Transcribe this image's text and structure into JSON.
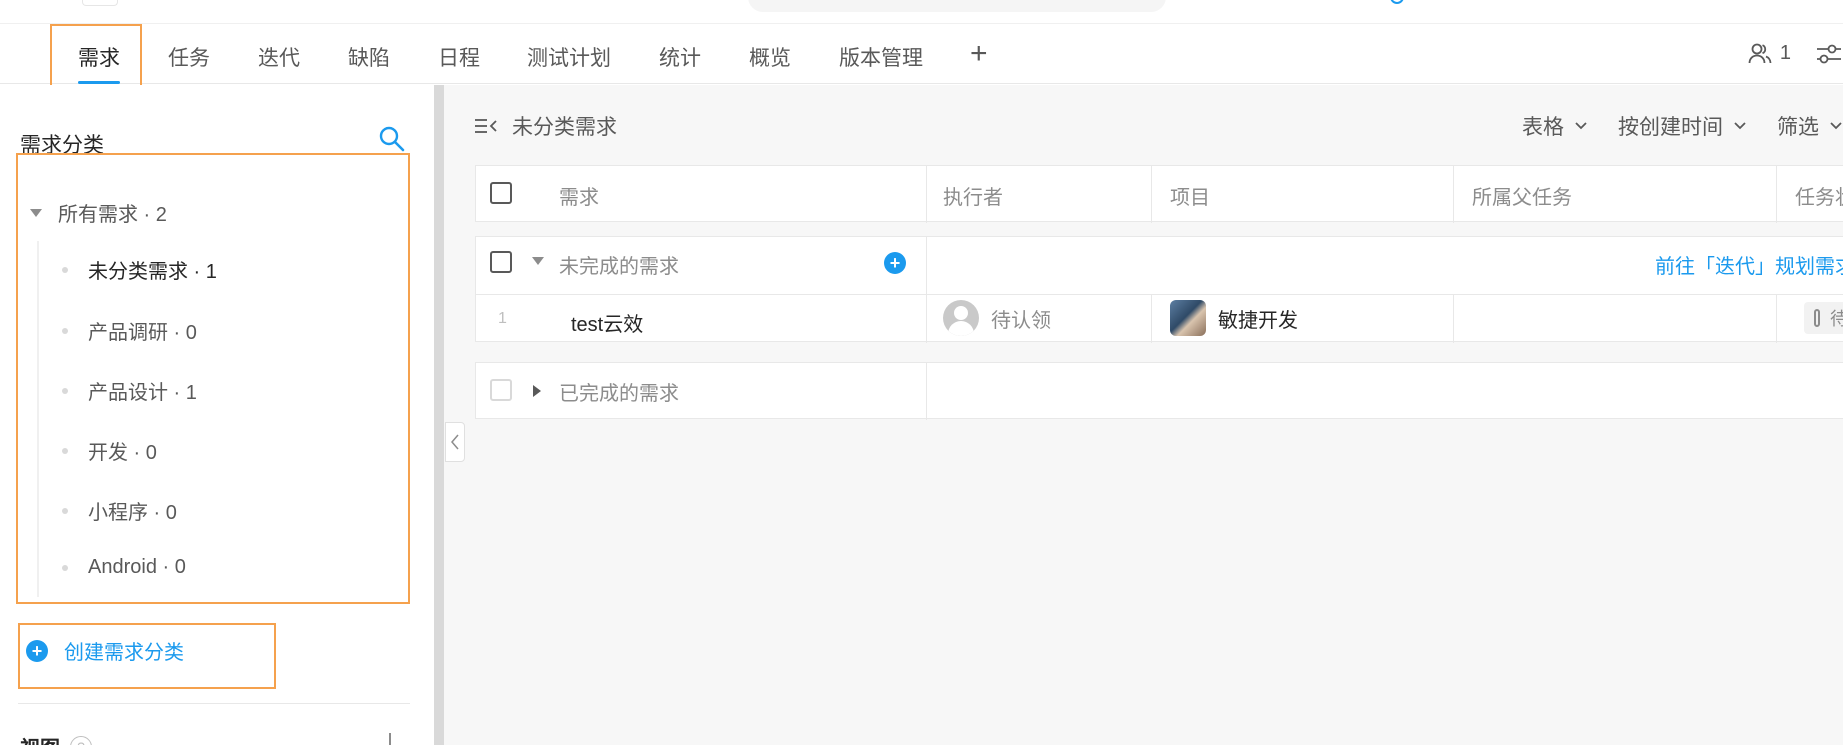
{
  "tabs": [
    {
      "label": "需求",
      "active": true
    },
    {
      "label": "任务"
    },
    {
      "label": "迭代"
    },
    {
      "label": "缺陷"
    },
    {
      "label": "日程"
    },
    {
      "label": "测试计划"
    },
    {
      "label": "统计"
    },
    {
      "label": "概览"
    },
    {
      "label": "版本管理"
    }
  ],
  "tab_add": "+",
  "members_count": "1",
  "sidebar": {
    "title": "需求分类",
    "root": "所有需求 · 2",
    "items": [
      {
        "label": "未分类需求 · 1",
        "selected": true
      },
      {
        "label": "产品调研 · 0"
      },
      {
        "label": "产品设计 · 1"
      },
      {
        "label": "开发 · 0"
      },
      {
        "label": "小程序 · 0"
      },
      {
        "label": "Android · 0"
      }
    ],
    "create_label": "创建需求分类",
    "view_label": "视图",
    "help": "?"
  },
  "main": {
    "crumb": "未分类需求",
    "toolbar": [
      "表格",
      "按创建时间",
      "筛选"
    ],
    "columns": [
      "需求",
      "执行者",
      "项目",
      "所属父任务",
      "任务状态"
    ],
    "group_open": {
      "label": "未完成的需求",
      "plan_link": "前往「迭代」规划需求"
    },
    "row": {
      "index": "1",
      "title": "test云效",
      "assignee": "待认领",
      "project": "敏捷开发",
      "parent": "",
      "status": "待处理"
    },
    "group_done": {
      "label": "已完成的需求"
    }
  },
  "colors": {
    "accent": "#1b9aee",
    "highlight": "#f5a14d"
  }
}
